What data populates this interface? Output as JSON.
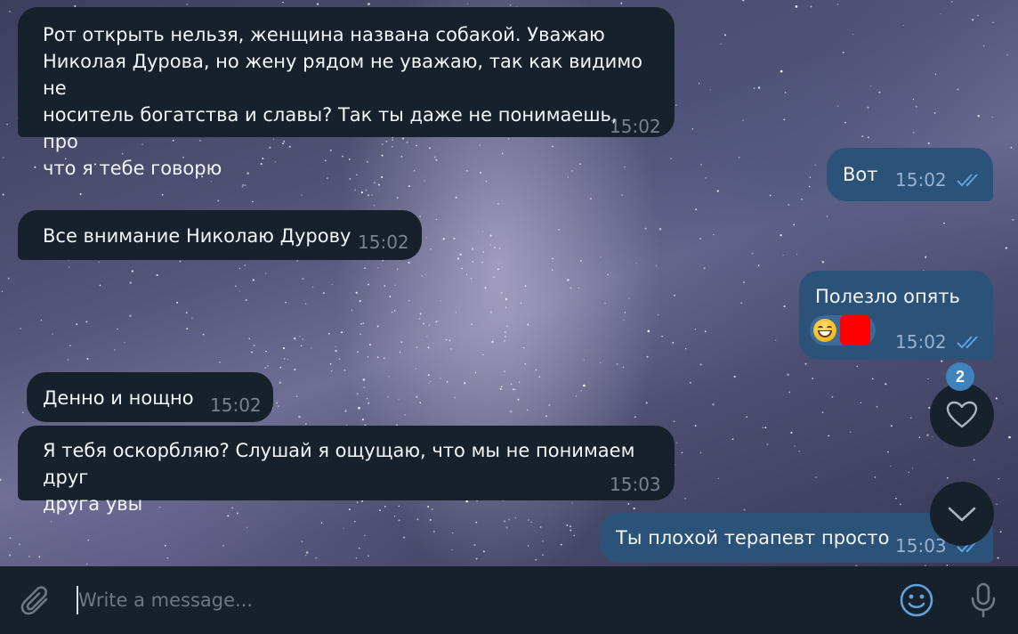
{
  "colors": {
    "incoming_bubble": "#17212b",
    "outgoing_bubble": "#2b5278",
    "composer_bg": "#17212b",
    "badge_bg": "#4082bc",
    "check_color": "#5fa3de"
  },
  "messages": [
    {
      "direction": "incoming",
      "text": "Рот открыть нельзя, женщина названа собакой. Уважаю\nНиколая Дурова, но жену рядом не уважаю, так как видимо не\nноситель богатства и славы? Так ты даже не понимаешь, про\nчто я тебе говорю",
      "time": "15:02"
    },
    {
      "direction": "outgoing",
      "text": "Вот",
      "time": "15:02",
      "status": "read"
    },
    {
      "direction": "incoming",
      "text": "Все внимание Николаю Дурову",
      "time": "15:02"
    },
    {
      "direction": "outgoing",
      "text": "Полезло опять",
      "time": "15:02",
      "status": "read",
      "reactions": [
        "grinning-face-emoji",
        "red-square-emoji"
      ]
    },
    {
      "direction": "incoming",
      "text": "Денно и нощно",
      "time": "15:02"
    },
    {
      "direction": "incoming",
      "text": "Я тебя оскорбляю? Слушай я ощущаю, что мы не понимаем друг\nдруга увы",
      "time": "15:03"
    },
    {
      "direction": "outgoing",
      "text": "Ты плохой терапевт просто",
      "time": "15:03",
      "status": "read"
    }
  ],
  "reactions_button": {
    "icon": "heart-icon",
    "count": "2"
  },
  "scroll_down_button": {
    "icon": "chevron-down-icon"
  },
  "composer": {
    "placeholder": "Write a message...",
    "value": "",
    "attach_icon": "paperclip-icon",
    "emoji_icon": "smiley-icon",
    "voice_icon": "microphone-icon"
  }
}
